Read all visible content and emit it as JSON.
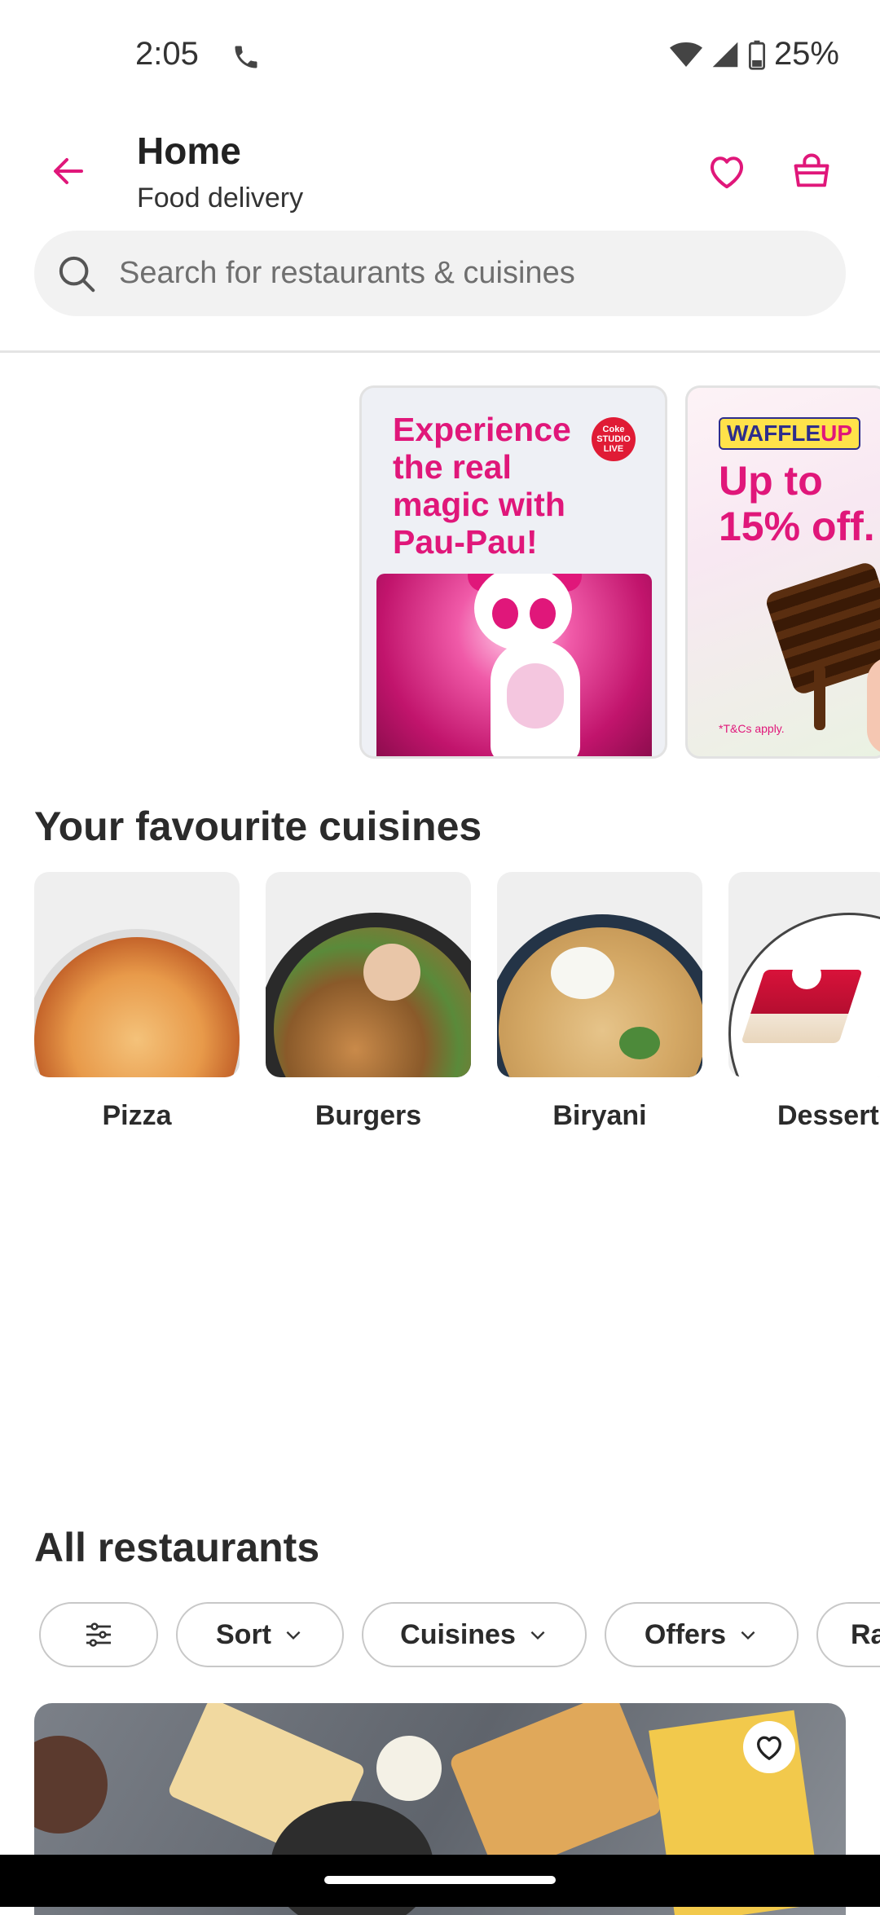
{
  "status_bar": {
    "time": "2:05",
    "battery": "25%"
  },
  "header": {
    "title": "Home",
    "subtitle": "Food delivery"
  },
  "search": {
    "placeholder": "Search for restaurants & cuisines"
  },
  "banners": [
    {
      "headline": "Experience the real magic with Pau-Pau!",
      "logo_text": "Coke STUDIO LIVE"
    },
    {
      "brand": "WAFFLE",
      "brand_accent": "UP",
      "headline": "Up to 15% off.",
      "terms": "*T&Cs apply."
    }
  ],
  "cuisines": {
    "title": "Your favourite cuisines",
    "items": [
      {
        "label": "Pizza"
      },
      {
        "label": "Burgers"
      },
      {
        "label": "Biryani"
      },
      {
        "label": "Dessert"
      }
    ]
  },
  "restaurants": {
    "title": "All restaurants",
    "filters": [
      {
        "label": "",
        "icon": "sliders-icon"
      },
      {
        "label": "Sort"
      },
      {
        "label": "Cuisines"
      },
      {
        "label": "Offers"
      },
      {
        "label": "Ra"
      }
    ]
  },
  "colors": {
    "accent": "#e0177a"
  }
}
